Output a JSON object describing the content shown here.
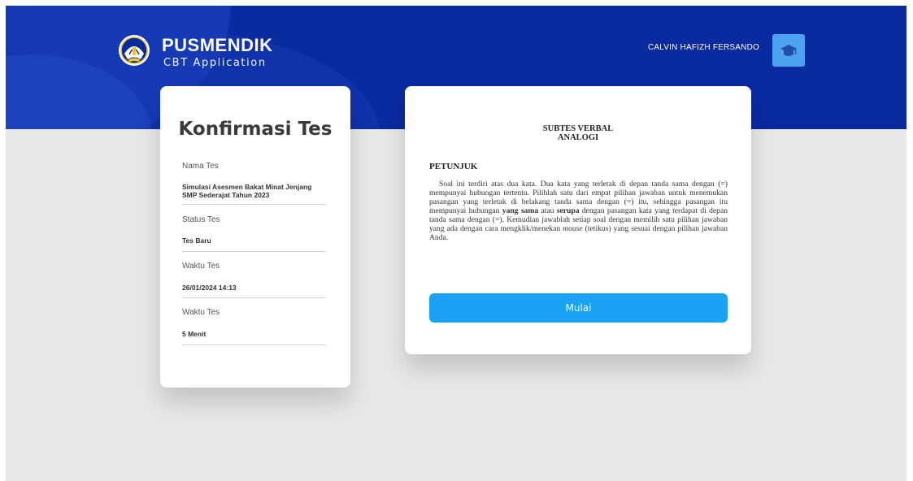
{
  "header": {
    "brand_title": "PUSMENDIK",
    "brand_subtitle": "CBT Application",
    "user_name": "CALVIN HAFIZH FERSANDO",
    "logo_icon": "tut-wuri-handayani-emblem-icon",
    "avatar_icon": "graduation-cap-icon"
  },
  "confirmation": {
    "title": "Konfirmasi Tes",
    "fields": [
      {
        "label": "Nama Tes",
        "value": "Simulasi Asesmen Bakat Minat Jenjang SMP Sederajat Tahun 2023"
      },
      {
        "label": "Status Tes",
        "value": "Tes Baru"
      },
      {
        "label": "Waktu Tes",
        "value": "26/01/2024 14:13"
      },
      {
        "label": "Waktu Tes",
        "value": "5 Menit"
      }
    ]
  },
  "instructions": {
    "subtest_line1": "SUBTES VERBAL",
    "subtest_line2": "ANALOGI",
    "heading": "PETUNJUK",
    "body_part1": "Soal ini terdiri atas dua kata. Dua kata yang terletak di depan tanda sama dengan (=) mempunyai hubungan tertentu. Pilihlah satu dari empat pilihan jawaban untuk menemukan pasangan yang terletak di belakang tanda sama dengan (=) itu, sehingga pasangan itu mempunyai hubungan",
    "bold1": "yang sama",
    "text_atau": "atau",
    "bold2": "serupa",
    "body_part2": "dengan pasangan kata yang terdapat di depan tanda sama dengan (=). Kemudian jawablah setiap soal dengan memilih satu pilihan jawaban yang ada dengan cara mengklik/menekan",
    "italic": "mouse",
    "body_part3": "(tetikus) yang sesuai dengan pilihan jawaban Anda.",
    "start_button": "Mulai"
  },
  "colors": {
    "header_bg": "#0a2aa0",
    "accent_button": "#1aa3f5",
    "avatar_bg": "#4da3f0",
    "page_bg": "#e8e8e8"
  }
}
